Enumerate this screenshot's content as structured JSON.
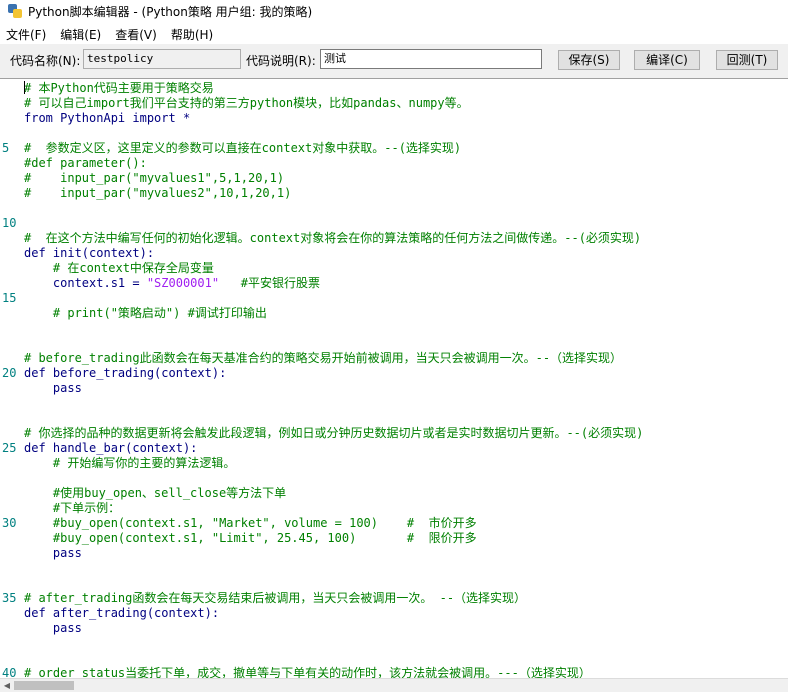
{
  "window": {
    "title": "Python脚本编辑器 - (Python策略 用户组: 我的策略)"
  },
  "menu": [
    "文件(F)",
    "编辑(E)",
    "查看(V)",
    "帮助(H)"
  ],
  "toolbar": {
    "name_label": "代码名称(N):",
    "name_value": "testpolicy",
    "desc_label": "代码说明(R):",
    "desc_value": "测试",
    "save_label": "保存(S)",
    "compile_label": "编译(C)",
    "back_label": "回测(T)"
  },
  "line_numbers": [
    "5",
    "10",
    "15",
    "20",
    "25",
    "30",
    "35",
    "40"
  ],
  "code_lines": [
    {
      "t": "# 本Python代码主要用于策略交易",
      "c": "comment"
    },
    {
      "t": "# 可以自己import我们平台支持的第三方python模块，比如pandas、numpy等。",
      "c": "comment"
    },
    {
      "t": "from PythonApi import *",
      "c": "code"
    },
    {
      "t": "",
      "c": "code"
    },
    {
      "t": "#  参数定义区，这里定义的参数可以直接在context对象中获取。--(选择实现)",
      "c": "comment"
    },
    {
      "t": "#def parameter():",
      "c": "comment"
    },
    {
      "t": "#    input_par(\"myvalues1\",5,1,20,1)",
      "c": "comment"
    },
    {
      "t": "#    input_par(\"myvalues2\",10,1,20,1)",
      "c": "comment"
    },
    {
      "t": "",
      "c": "code"
    },
    {
      "t": "",
      "c": "code"
    },
    {
      "t": "#  在这个方法中编写任何的初始化逻辑。context对象将会在你的算法策略的任何方法之间做传递。--(必须实现)",
      "c": "comment"
    },
    {
      "t": "def init(context):",
      "c": "code"
    },
    {
      "t": "    # 在context中保存全局变量",
      "c": "comment"
    },
    {
      "t": "    context.s1 = ",
      "c": "code",
      "s": "\"SZ000001\"",
      "rest": "   #平安银行股票"
    },
    {
      "t": "",
      "c": "code"
    },
    {
      "t": "    # print(\"策略启动\") #调试打印输出",
      "c": "comment"
    },
    {
      "t": "",
      "c": "code"
    },
    {
      "t": "",
      "c": "code"
    },
    {
      "t": "# before_trading此函数会在每天基准合约的策略交易开始前被调用，当天只会被调用一次。--（选择实现）",
      "c": "comment"
    },
    {
      "t": "def before_trading(context):",
      "c": "code"
    },
    {
      "t": "    pass",
      "c": "code"
    },
    {
      "t": "",
      "c": "code"
    },
    {
      "t": "",
      "c": "code"
    },
    {
      "t": "# 你选择的品种的数据更新将会触发此段逻辑，例如日或分钟历史数据切片或者是实时数据切片更新。--(必须实现)",
      "c": "comment"
    },
    {
      "t": "def handle_bar(context):",
      "c": "code"
    },
    {
      "t": "    # 开始编写你的主要的算法逻辑。",
      "c": "comment"
    },
    {
      "t": "",
      "c": "code"
    },
    {
      "t": "    #使用buy_open、sell_close等方法下单",
      "c": "comment"
    },
    {
      "t": "    #下单示例：",
      "c": "comment"
    },
    {
      "t": "    #buy_open(context.s1, \"Market\", volume = 100)    #  市价开多",
      "c": "comment"
    },
    {
      "t": "    #buy_open(context.s1, \"Limit\", 25.45, 100)       #  限价开多",
      "c": "comment"
    },
    {
      "t": "    pass",
      "c": "code"
    },
    {
      "t": "",
      "c": "code"
    },
    {
      "t": "",
      "c": "code"
    },
    {
      "t": "# after_trading函数会在每天交易结束后被调用，当天只会被调用一次。 --（选择实现）",
      "c": "comment"
    },
    {
      "t": "def after_trading(context):",
      "c": "code"
    },
    {
      "t": "    pass",
      "c": "code"
    },
    {
      "t": "",
      "c": "code"
    },
    {
      "t": "",
      "c": "code"
    },
    {
      "t": "# order_status当委托下单，成交，撤单等与下单有关的动作时，该方法就会被调用。---（选择实现）",
      "c": "comment"
    }
  ],
  "colors": {
    "comment": "#008000",
    "code": "#000080",
    "string": "#a020f0",
    "line_number": "#008080"
  }
}
